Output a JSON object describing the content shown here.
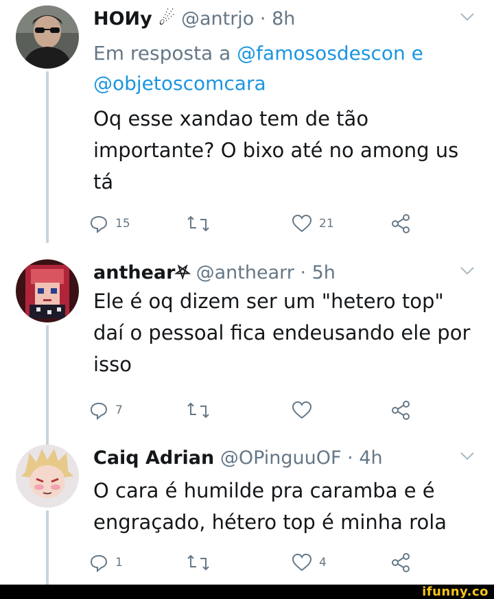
{
  "tweets": [
    {
      "name": "HOИy ☄",
      "handle": "@antrjo",
      "time": "· 8h",
      "reply_prefix": "Em resposta a ",
      "reply_mentions": "@famososdescon e @objetoscomcara",
      "text": "Oq esse xandao tem de tão importante? O bixo até no among us tá",
      "replies": "15",
      "retweets": "",
      "likes": "21"
    },
    {
      "name": "anthear⛧",
      "handle": "@anthearr",
      "time": "· 5h",
      "text": "Ele é oq dizem ser um \"hetero top\" daí o pessoal fica endeusando ele por isso",
      "replies": "7",
      "retweets": "",
      "likes": ""
    },
    {
      "name": "Caiq Adrian",
      "handle": "@OPinguuOF",
      "time": "· 4h",
      "text": "O cara é humilde pra caramba e é engraçado, hétero top é minha rola",
      "replies": "1",
      "retweets": "",
      "likes": "4"
    }
  ],
  "watermark": "ifunny.co",
  "colors": {
    "name": "#14171a",
    "secondary": "#657786",
    "link": "#1b95e0",
    "thread_line": "#c9d3db",
    "watermark": "#f5c518"
  },
  "icons": [
    "reply-icon",
    "retweet-icon",
    "like-icon",
    "share-icon",
    "chevron-down-icon"
  ]
}
